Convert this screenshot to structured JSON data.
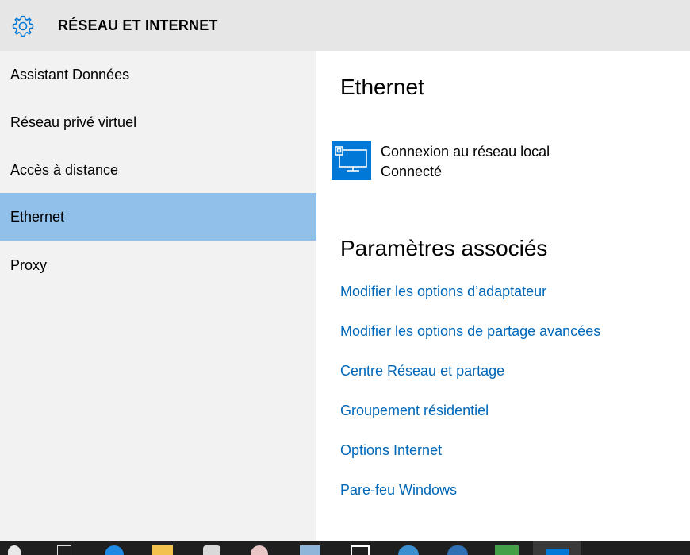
{
  "header": {
    "title": "RÉSEAU ET INTERNET",
    "icon": "gear-icon"
  },
  "sidebar": {
    "items": [
      {
        "label": "Assistant Données"
      },
      {
        "label": "Réseau privé virtuel"
      },
      {
        "label": "Accès à distance"
      },
      {
        "label": "Ethernet",
        "selected": true
      },
      {
        "label": "Proxy"
      }
    ]
  },
  "main": {
    "title": "Ethernet",
    "connection": {
      "name": "Connexion au réseau local",
      "status": "Connecté",
      "icon": "ethernet-monitor-icon"
    },
    "related_title": "Paramètres associés",
    "links": [
      {
        "label": "Modifier les options d’adaptateur"
      },
      {
        "label": "Modifier les options de partage avancées"
      },
      {
        "label": "Centre Réseau et partage"
      },
      {
        "label": "Groupement résidentiel"
      },
      {
        "label": "Options Internet"
      },
      {
        "label": "Pare-feu Windows"
      }
    ]
  },
  "colors": {
    "accent": "#0078d7",
    "link": "#0067b8",
    "selected_bg": "#91c1eb",
    "header_bg": "#e6e6e6",
    "sidebar_bg": "#f2f2f2",
    "taskbar_bg": "#1f1f1f"
  }
}
